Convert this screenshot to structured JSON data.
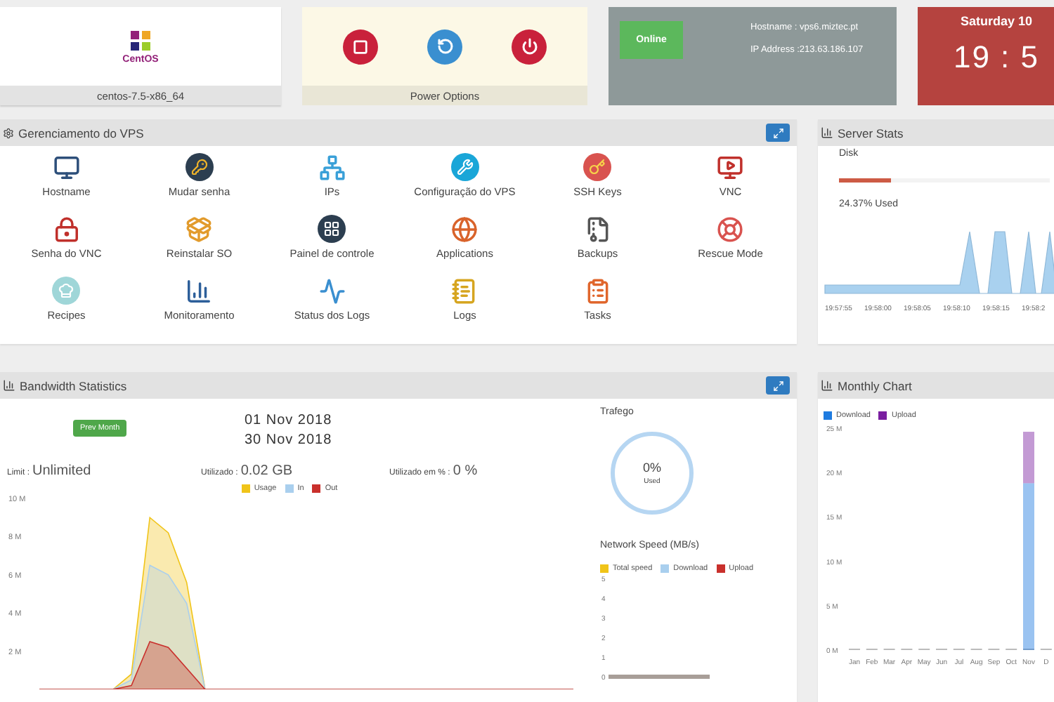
{
  "os_card": {
    "logo_text": "CentOS",
    "name": "centos-7.5-x86_64"
  },
  "power_card": {
    "title": "Power Options"
  },
  "status_card": {
    "status": "Online",
    "hostname": "Hostname : vps6.miztec.pt",
    "ip": "IP Address :213.63.186.107"
  },
  "date_card": {
    "date": "Saturday 10",
    "time": "19 : 5"
  },
  "vps_panel": {
    "title": "Gerenciamento do VPS",
    "items": [
      {
        "label": "Hostname",
        "kind": "monitor"
      },
      {
        "label": "Mudar senha",
        "kind": "password"
      },
      {
        "label": "IPs",
        "kind": "network"
      },
      {
        "label": "Configuração do VPS",
        "kind": "tools"
      },
      {
        "label": "SSH Keys",
        "kind": "key"
      },
      {
        "label": "VNC",
        "kind": "vnc"
      },
      {
        "label": "Senha do VNC",
        "kind": "vnc-lock"
      },
      {
        "label": "Reinstalar SO",
        "kind": "install"
      },
      {
        "label": "Painel de controle",
        "kind": "panel"
      },
      {
        "label": "Applications",
        "kind": "apps"
      },
      {
        "label": "Backups",
        "kind": "archive"
      },
      {
        "label": "Rescue Mode",
        "kind": "rescue"
      },
      {
        "label": "Recipes",
        "kind": "chef"
      },
      {
        "label": "Monitoramento",
        "kind": "monitoring"
      },
      {
        "label": "Status dos Logs",
        "kind": "log-status"
      },
      {
        "label": "Logs",
        "kind": "logs"
      },
      {
        "label": "Tasks",
        "kind": "tasks"
      }
    ]
  },
  "server_stats": {
    "title": "Server Stats",
    "disk_label": "Disk",
    "level": 0.2437,
    "used": "24.37% Used",
    "time_labels": [
      "19:57:55",
      "19:58:00",
      "19:58:05",
      "19:58:10",
      "19:58:15",
      "19:58:2"
    ]
  },
  "bandwidth": {
    "title": "Bandwidth Statistics",
    "prev_button": "Prev Month",
    "start_date": "01 Nov 2018",
    "end_date": "30 Nov 2018",
    "limit_label": "Limit :",
    "limit_value": "Unlimited",
    "used_label": "Utilizado :",
    "used_value": "0.02 GB",
    "pct_label": "Utilizado em % :",
    "pct_value": "0 %",
    "chart_data": {
      "type": "area",
      "ylim": [
        0,
        10
      ],
      "yticks": [
        {
          "value": 2,
          "label": "2 M"
        },
        {
          "value": 4,
          "label": "4 M"
        },
        {
          "value": 6,
          "label": "6 M"
        },
        {
          "value": 8,
          "label": "8 M"
        },
        {
          "value": 10,
          "label": "10 M"
        }
      ],
      "series": [
        {
          "name": "Usage",
          "color": "#f0c419",
          "values": [
            0,
            0,
            0,
            0,
            0,
            0.8,
            9,
            8.2,
            5.6,
            0,
            0,
            0,
            0,
            0,
            0,
            0,
            0,
            0,
            0,
            0,
            0,
            0,
            0,
            0,
            0,
            0,
            0,
            0,
            0,
            0
          ]
        },
        {
          "name": "In",
          "color": "#a9cfee",
          "values": [
            0,
            0,
            0,
            0,
            0,
            0.5,
            6.5,
            6,
            4.5,
            0,
            0,
            0,
            0,
            0,
            0,
            0,
            0,
            0,
            0,
            0,
            0,
            0,
            0,
            0,
            0,
            0,
            0,
            0,
            0,
            0
          ]
        },
        {
          "name": "Out",
          "color": "#c9302c",
          "values": [
            0,
            0,
            0,
            0,
            0,
            0.2,
            2.5,
            2.2,
            1.1,
            0,
            0,
            0,
            0,
            0,
            0,
            0,
            0,
            0,
            0,
            0,
            0,
            0,
            0,
            0,
            0,
            0,
            0,
            0,
            0,
            0
          ]
        }
      ]
    },
    "traffic": {
      "title": "Trafego",
      "value": "0%",
      "caption": "Used"
    },
    "speed": {
      "title": "Network Speed (MB/s)",
      "legend": [
        {
          "name": "Total speed",
          "color": "#f0c419"
        },
        {
          "name": "Download",
          "color": "#a9cfee"
        },
        {
          "name": "Upload",
          "color": "#c9302c"
        }
      ],
      "y_labels": [
        "5",
        "4",
        "3",
        "2",
        "1",
        "0"
      ]
    }
  },
  "monthly": {
    "title": "Monthly Chart",
    "chart_data": {
      "type": "bar",
      "stacked": true,
      "categories": [
        "Jan",
        "Feb",
        "Mar",
        "Apr",
        "May",
        "Jun",
        "Jul",
        "Aug",
        "Sep",
        "Oct",
        "Nov",
        "D"
      ],
      "ylim": [
        0,
        25
      ],
      "yticks": [
        {
          "value": 0,
          "label": "0 M"
        },
        {
          "value": 5,
          "label": "5 M"
        },
        {
          "value": 10,
          "label": "10 M"
        },
        {
          "value": 15,
          "label": "15 M"
        },
        {
          "value": 20,
          "label": "20 M"
        },
        {
          "value": 25,
          "label": "25 M"
        }
      ],
      "series": [
        {
          "name": "Download",
          "color": "#1e7be0",
          "values": [
            0,
            0,
            0,
            0,
            0,
            0,
            0,
            0,
            0,
            0,
            18.8,
            0
          ]
        },
        {
          "name": "Upload",
          "color": "#7a1ea0",
          "values": [
            0,
            0,
            0,
            0,
            0,
            0,
            0,
            0,
            0,
            0,
            5.8,
            0
          ]
        }
      ]
    }
  }
}
